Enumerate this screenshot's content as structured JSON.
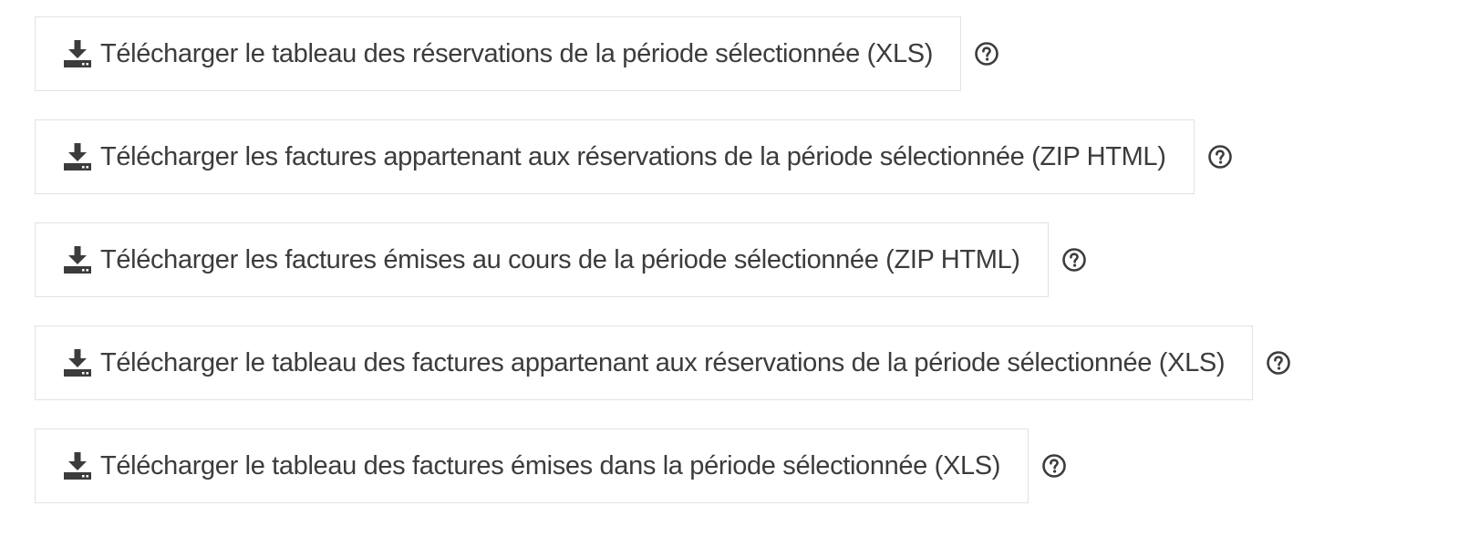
{
  "exports": {
    "items": [
      {
        "label": "Télécharger le tableau des réservations de la période sélectionnée (XLS)",
        "icon": "download-icon",
        "help_icon": "question-circle-icon"
      },
      {
        "label": "Télécharger les factures appartenant aux réservations de la période sélectionnée (ZIP HTML)",
        "icon": "download-icon",
        "help_icon": "question-circle-icon"
      },
      {
        "label": "Télécharger les factures émises au cours de la période sélectionnée (ZIP HTML)",
        "icon": "download-icon",
        "help_icon": "question-circle-icon"
      },
      {
        "label": "Télécharger le tableau des factures appartenant aux réservations de la période sélectionnée (XLS)",
        "icon": "download-icon",
        "help_icon": "question-circle-icon"
      },
      {
        "label": "Télécharger le tableau des factures émises dans la période sélectionnée (XLS)",
        "icon": "download-icon",
        "help_icon": "question-circle-icon"
      }
    ]
  },
  "colors": {
    "text": "#3c3c3c",
    "border": "#e2e2e2",
    "icon": "#3c3c3c",
    "background": "#ffffff"
  }
}
